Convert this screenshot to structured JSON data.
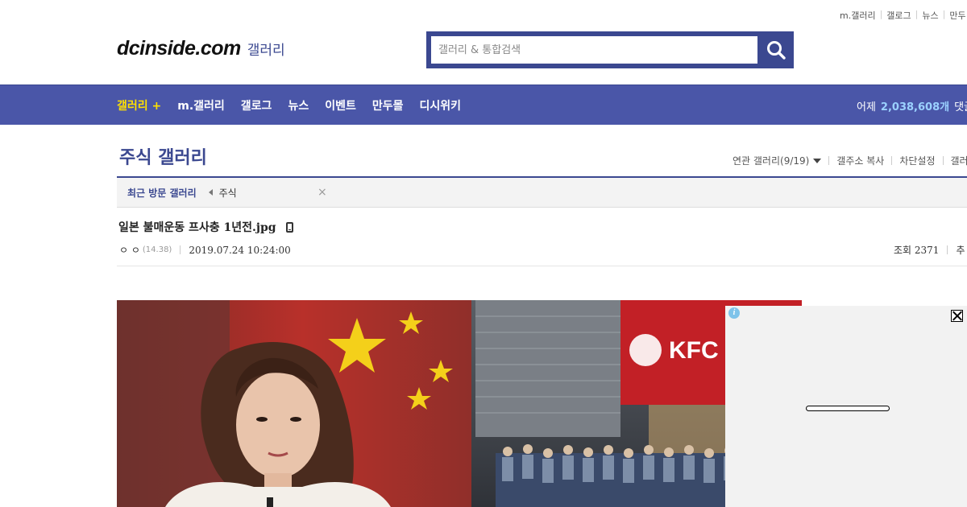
{
  "top_links": [
    "m.갤러리",
    "갤로그",
    "뉴스",
    "만두"
  ],
  "header": {
    "brand": "dcinside.com",
    "section": "갤러리",
    "search_placeholder": "갤러리 & 통합검색",
    "search_icon": "search-icon"
  },
  "nav": {
    "items": [
      "갤러리 +",
      "m.갤러리",
      "갤로그",
      "뉴스",
      "이벤트",
      "만두몰",
      "디시위키"
    ],
    "stats_label": "어제",
    "stats_value": "2,038,608개",
    "stats_suffix": "댓글"
  },
  "gallery": {
    "title": "주식 갤러리",
    "related": "연관 갤러리(9/19)",
    "copy_addr": "갤주소 복사",
    "block_settings": "차단설정",
    "more": "갤러"
  },
  "recent": {
    "label": "최근 방문 갤러리",
    "items": [
      "주식"
    ]
  },
  "post": {
    "title": "일본 불매운동 프사충 1년전.jpg",
    "author": "ㅇ ㅇ",
    "ip": "(14.38)",
    "date": "2019.07.24 10:24:00",
    "views_label": "조회 2371",
    "recommend_label": "추"
  },
  "image": {
    "kfc_sign": "KFC"
  },
  "colors": {
    "brand": "#3b4890",
    "nav_bg": "#4a56a8",
    "nav_active": "#ffe100",
    "stats_num": "#9bd1ff"
  }
}
